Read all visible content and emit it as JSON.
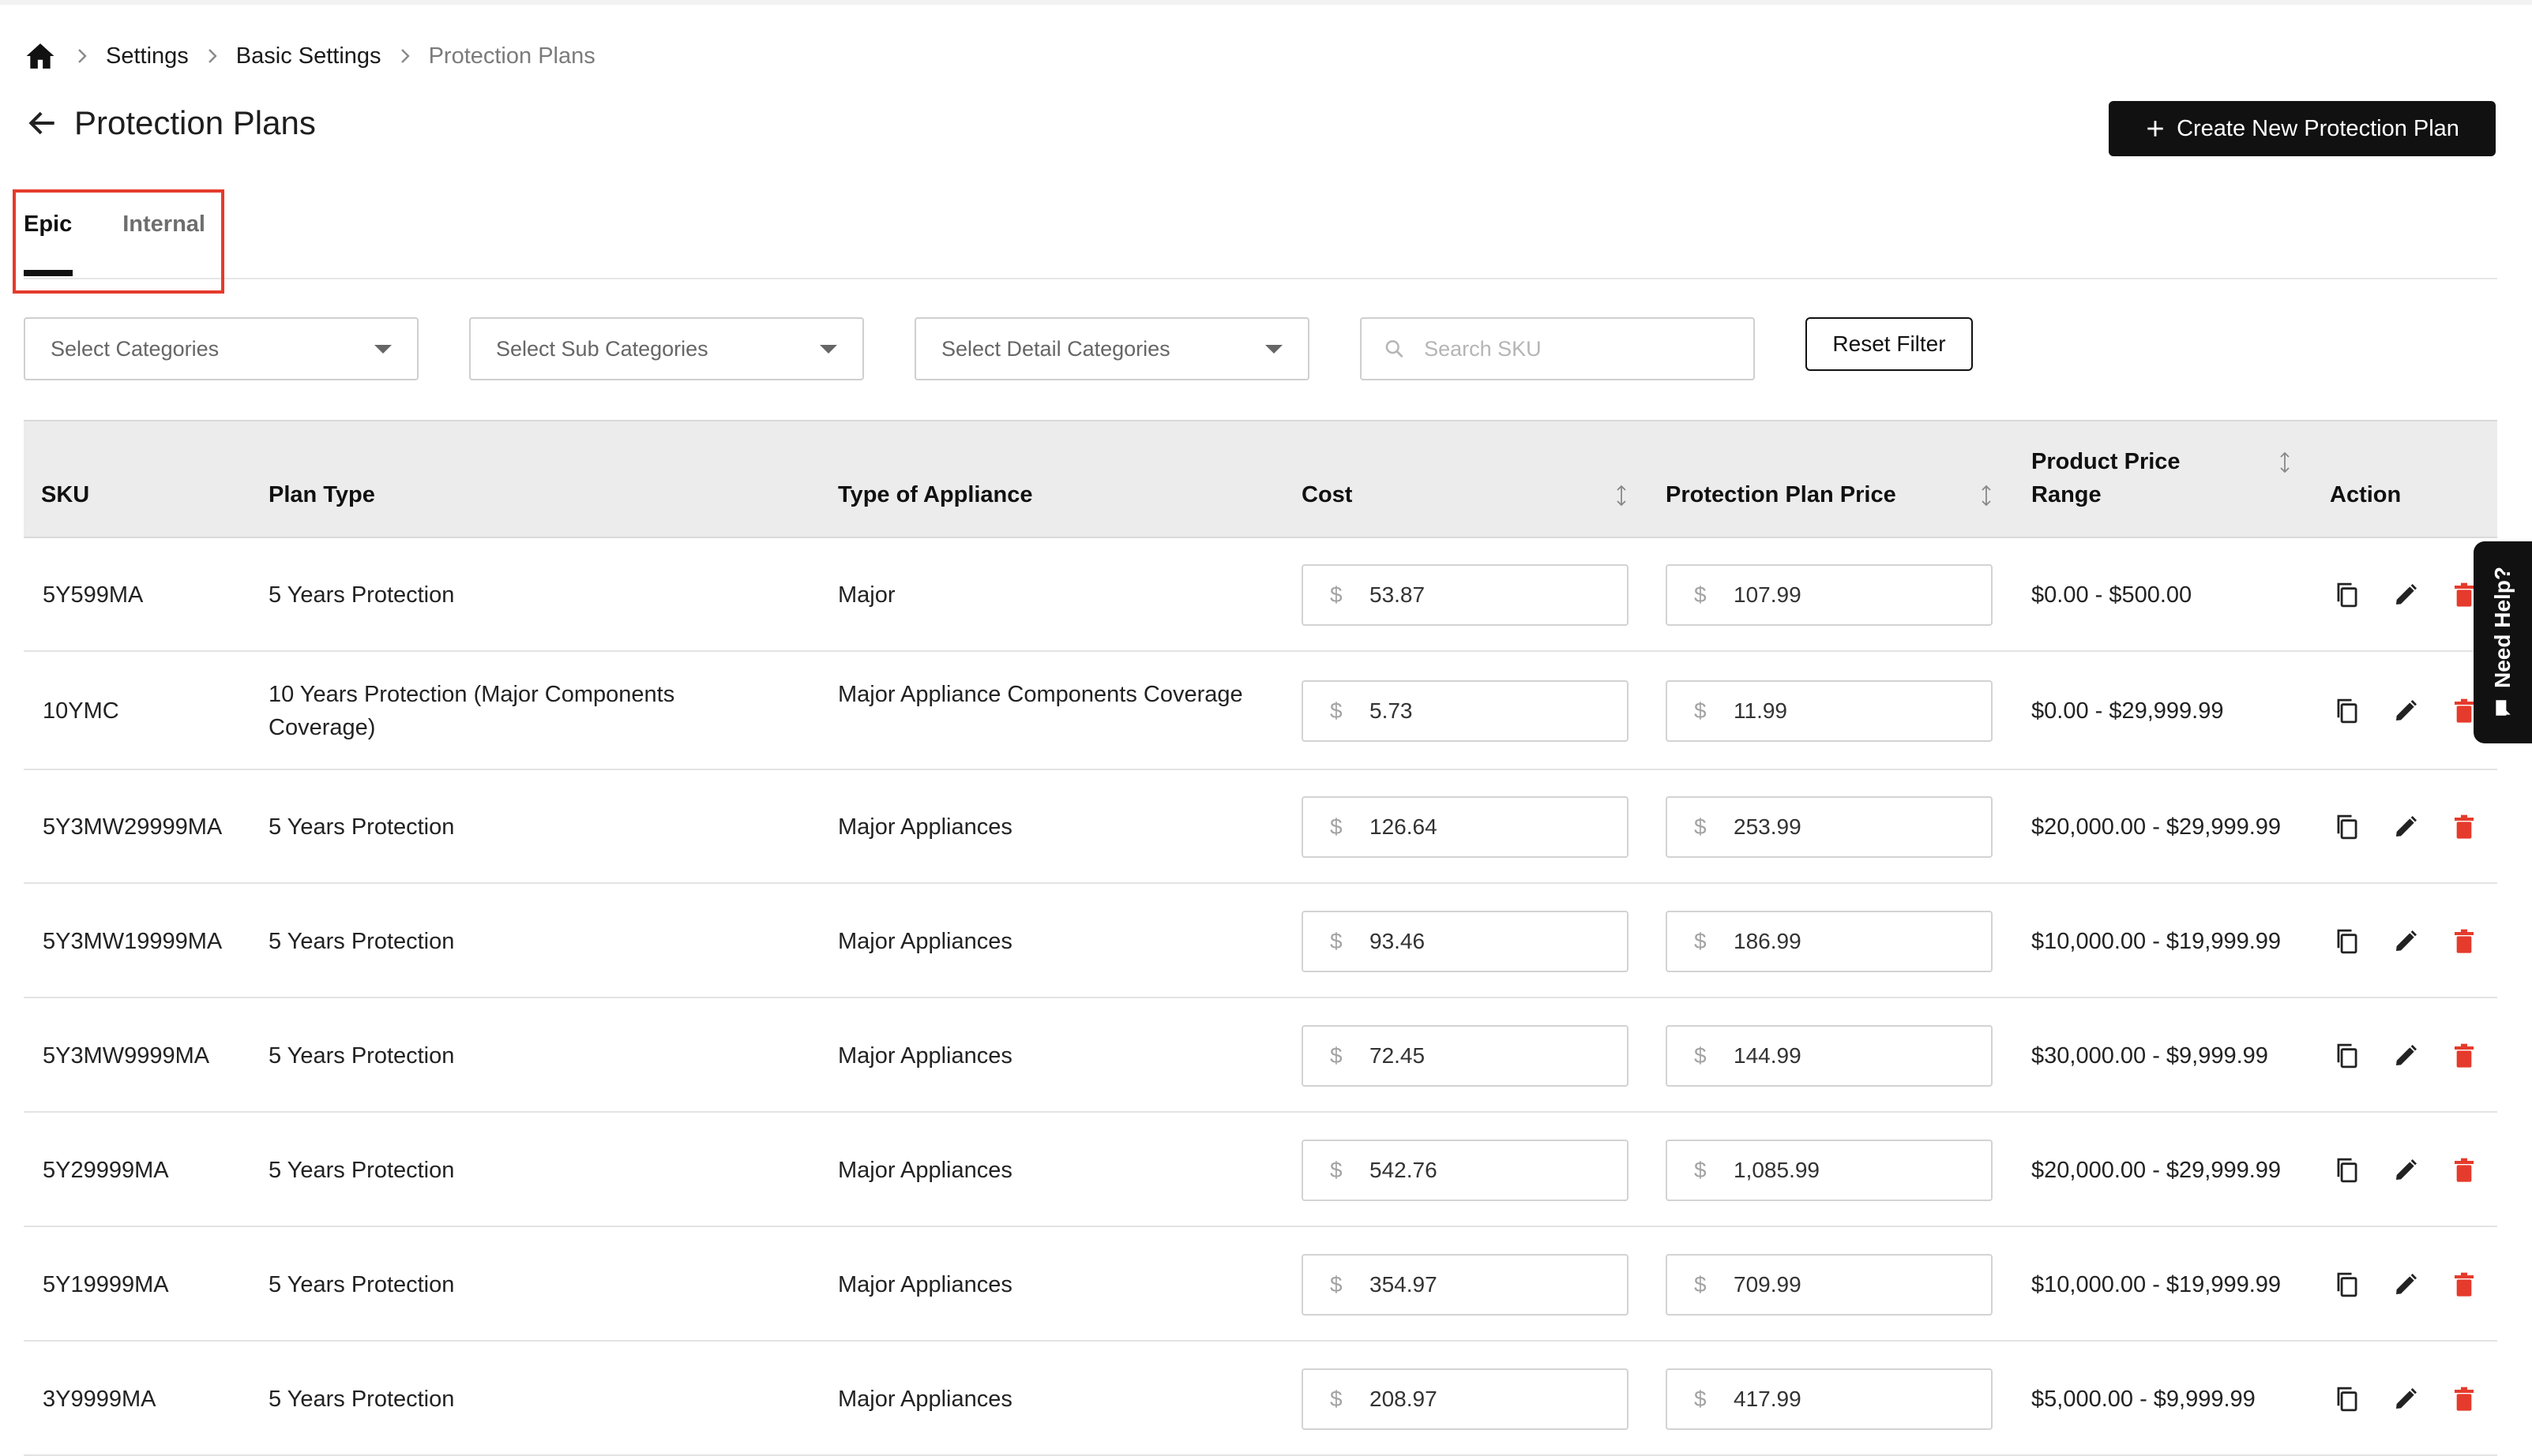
{
  "breadcrumb": {
    "home_icon": "home-icon",
    "items": [
      "Settings",
      "Basic Settings",
      "Protection Plans"
    ]
  },
  "header": {
    "title": "Protection Plans",
    "create_button": "Create New Protection Plan"
  },
  "tabs": [
    "Epic",
    "Internal"
  ],
  "filters": {
    "categories": "Select Categories",
    "sub_categories": "Select Sub Categories",
    "detail_categories": "Select Detail Categories",
    "search_placeholder": "Search SKU",
    "reset": "Reset Filter"
  },
  "table": {
    "columns": {
      "sku": "SKU",
      "plan_type": "Plan Type",
      "appliance": "Type of Appliance",
      "cost": "Cost",
      "plan_price": "Protection Plan Price",
      "range_line1": "Product Price",
      "range_line2": "Range",
      "action": "Action"
    },
    "currency": "$",
    "rows": [
      {
        "sku": "5Y599MA",
        "plan": "5 Years Protection",
        "appliance": "Major",
        "cost": "53.87",
        "price": "107.99",
        "range": "$0.00 - $500.00"
      },
      {
        "sku": "10YMC",
        "plan": "10 Years Protection (Major Components Coverage)",
        "appliance": "Major Appliance Components Coverage",
        "cost": "5.73",
        "price": "11.99",
        "range": "$0.00 - $29,999.99"
      },
      {
        "sku": "5Y3MW29999MA",
        "plan": "5 Years Protection",
        "appliance": "Major Appliances",
        "cost": "126.64",
        "price": "253.99",
        "range": "$20,000.00 - $29,999.99"
      },
      {
        "sku": "5Y3MW19999MA",
        "plan": "5 Years Protection",
        "appliance": "Major Appliances",
        "cost": "93.46",
        "price": "186.99",
        "range": "$10,000.00 - $19,999.99"
      },
      {
        "sku": "5Y3MW9999MA",
        "plan": "5 Years Protection",
        "appliance": "Major Appliances",
        "cost": "72.45",
        "price": "144.99",
        "range": "$30,000.00 - $9,999.99"
      },
      {
        "sku": "5Y29999MA",
        "plan": "5 Years Protection",
        "appliance": "Major Appliances",
        "cost": "542.76",
        "price": "1,085.99",
        "range": "$20,000.00 - $29,999.99"
      },
      {
        "sku": "5Y19999MA",
        "plan": "5 Years Protection",
        "appliance": "Major Appliances",
        "cost": "354.97",
        "price": "709.99",
        "range": "$10,000.00 - $19,999.99"
      },
      {
        "sku": "3Y9999MA",
        "plan": "5 Years Protection",
        "appliance": "Major Appliances",
        "cost": "208.97",
        "price": "417.99",
        "range": "$5,000.00 - $9,999.99"
      }
    ]
  },
  "need_help": "Need Help?",
  "colors": {
    "accent": "#111111",
    "delete": "#e53b2c",
    "highlight": "#e53b2c"
  }
}
